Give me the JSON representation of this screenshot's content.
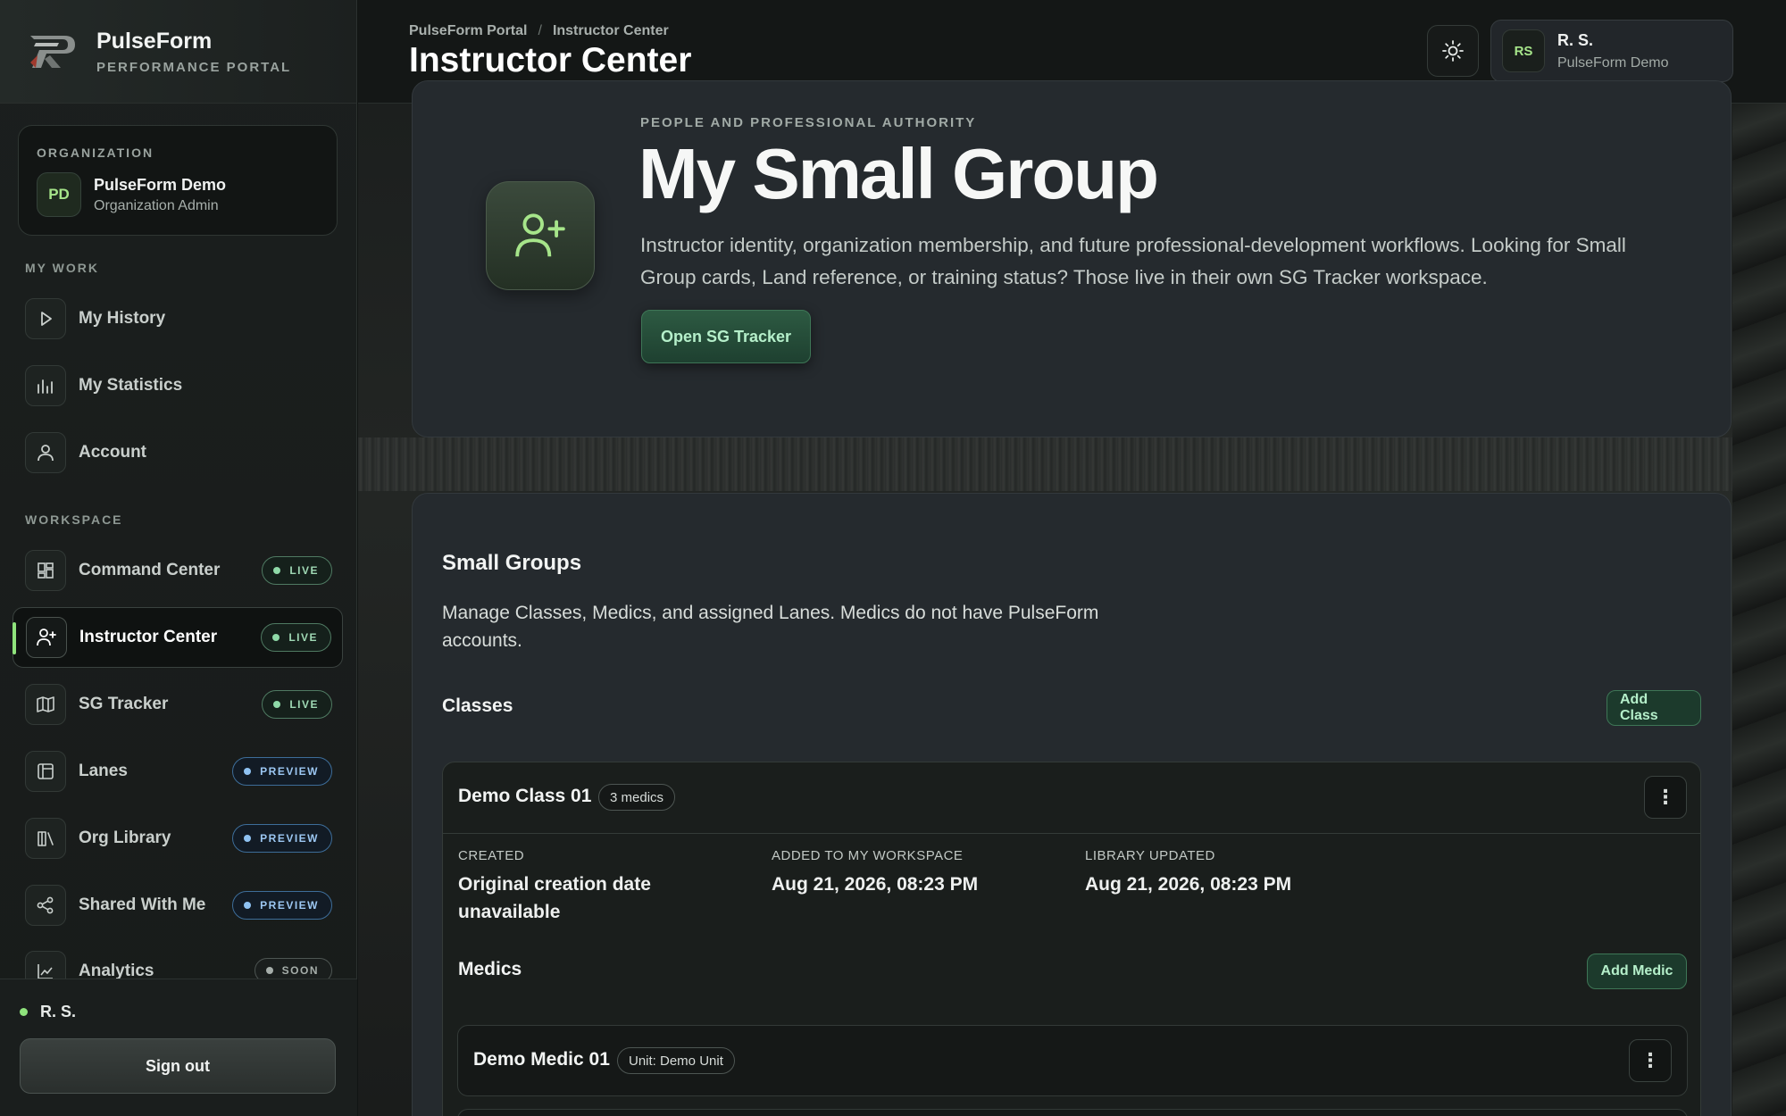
{
  "brand": {
    "name": "PulseForm",
    "subtitle": "PERFORMANCE PORTAL"
  },
  "organization": {
    "eyebrow": "ORGANIZATION",
    "initials": "PD",
    "name": "PulseForm Demo",
    "role": "Organization Admin"
  },
  "sidebar": {
    "my_work_label": "MY WORK",
    "my_work": [
      {
        "label": "My History",
        "icon": "play-icon"
      },
      {
        "label": "My Statistics",
        "icon": "bar-chart-icon"
      },
      {
        "label": "Account",
        "icon": "user-icon"
      }
    ],
    "workspace_label": "WORKSPACE",
    "workspace": [
      {
        "label": "Command Center",
        "icon": "dashboard-icon",
        "badge": "LIVE"
      },
      {
        "label": "Instructor Center",
        "icon": "user-plus-icon",
        "badge": "LIVE",
        "active": true
      },
      {
        "label": "SG Tracker",
        "icon": "map-icon",
        "badge": "LIVE"
      },
      {
        "label": "Lanes",
        "icon": "layout-icon",
        "badge": "PREVIEW"
      },
      {
        "label": "Org Library",
        "icon": "library-icon",
        "badge": "PREVIEW"
      },
      {
        "label": "Shared With Me",
        "icon": "share-icon",
        "badge": "PREVIEW"
      },
      {
        "label": "Analytics",
        "icon": "line-chart-icon",
        "badge": "SOON"
      }
    ],
    "footer_user": "R. S.",
    "sign_out_label": "Sign out"
  },
  "topbar": {
    "breadcrumb": [
      "PulseForm Portal",
      "Instructor Center"
    ],
    "breadcrumb_sep": "/",
    "title": "Instructor Center",
    "user_initials": "RS",
    "user_name": "R. S.",
    "user_org": "PulseForm Demo"
  },
  "hero": {
    "eyebrow": "PEOPLE AND PROFESSIONAL AUTHORITY",
    "title": "My Small Group",
    "description": "Instructor identity, organization membership, and future professional-development workflows. Looking for Small Group cards, Land reference, or training status? Those live in their own SG Tracker workspace.",
    "button_label": "Open SG Tracker"
  },
  "small_groups": {
    "title": "Small Groups",
    "description": "Manage Classes, Medics, and assigned Lanes. Medics do not have PulseForm accounts.",
    "classes_label": "Classes",
    "add_class_label": "Add Class",
    "class": {
      "name": "Demo Class 01",
      "medics_count": "3 medics",
      "created_label": "CREATED",
      "created_value": "Original creation date unavailable",
      "added_label": "ADDED TO MY WORKSPACE",
      "added_value": "Aug 21, 2026, 08:23 PM",
      "updated_label": "LIBRARY UPDATED",
      "updated_value": "Aug 21, 2026, 08:23 PM",
      "medics_label": "Medics",
      "add_medic_label": "Add Medic",
      "medics": [
        {
          "name": "Demo Medic 01",
          "unit": "Unit: Demo Unit"
        }
      ]
    }
  },
  "colors": {
    "accent_green": "#8fe37c",
    "live": "#8fd9a8",
    "preview": "#8fc2f2",
    "soon": "#a6aeaa"
  }
}
